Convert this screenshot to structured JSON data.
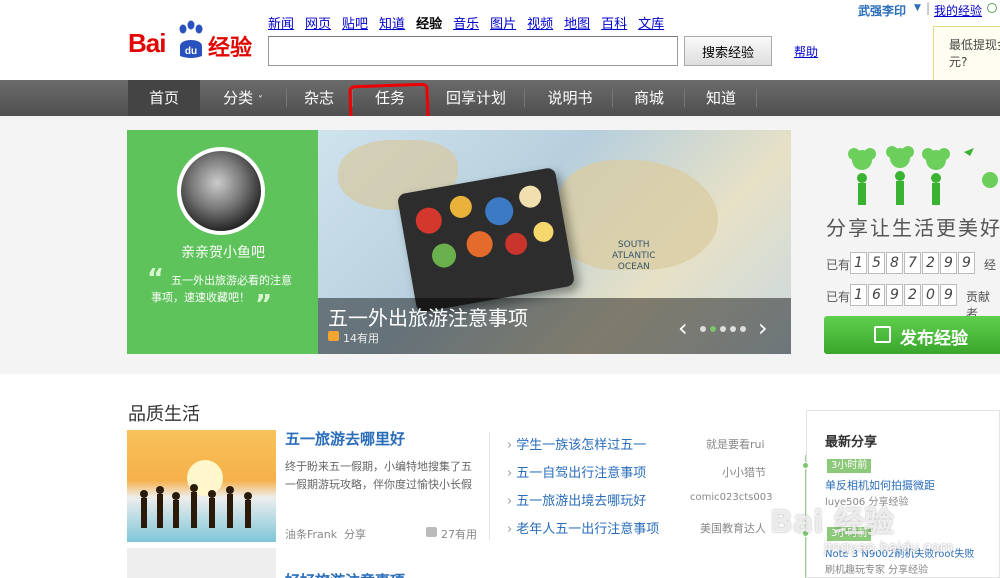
{
  "header": {
    "logo_text_bai": "Bai",
    "logo_text_du": "du",
    "logo_text_jy": "经验",
    "nav": [
      "新闻",
      "网页",
      "贴吧",
      "知道",
      "经验",
      "音乐",
      "图片",
      "视频",
      "地图",
      "百科",
      "文库"
    ],
    "current_nav": "经验",
    "search_placeholder": "",
    "search_button": "搜索经验",
    "help": "帮助",
    "user_name": "武强李印",
    "user_sep": "|",
    "my_experience": "我的经验",
    "tooltip_text": "最低提现金元?"
  },
  "main_nav": {
    "items": [
      "首页",
      "分类",
      "杂志",
      "任务",
      "回享计划",
      "说明书",
      "商城",
      "知道"
    ],
    "caret": "˅"
  },
  "promo": {
    "name": "亲亲贺小鱼吧",
    "quote_open": "“",
    "quote_close": "”",
    "text": "五一外出旅游必看的注意事项，速速收藏吧！"
  },
  "slide": {
    "title": "五一外出旅游注意事项",
    "useful": "14有用",
    "map_label": "SOUTH\nATLANTIC\nOCEAN",
    "prev": "‹",
    "next": "›",
    "dots": 5,
    "active_dot": 1
  },
  "share_panel": {
    "slogan": "分享让生活更美好",
    "row1_prefix": "已有",
    "row1_digits": [
      "1",
      "5",
      "8",
      "7",
      "2",
      "9",
      "9"
    ],
    "row1_suffix": "经",
    "row2_prefix": "已有",
    "row2_digits": [
      "1",
      "6",
      "9",
      "2",
      "0",
      "9"
    ],
    "row2_suffix": "贡献者",
    "publish": "发布经验"
  },
  "section": {
    "title": "品质生活",
    "featured": {
      "title": "五一旅游去哪里好",
      "desc": "终于盼来五一假期，小编特地搜集了五一假期游玩攻略，伴你度过愉快小长假",
      "author": "油条Frank",
      "share": "分享",
      "useful": "27有用"
    },
    "list": [
      {
        "title": "学生一族该怎样过五一",
        "author": "就是要看rui"
      },
      {
        "title": "五一自驾出行注意事项",
        "author": "小小猎节"
      },
      {
        "title": "五一旅游出境去哪玩好",
        "author": "comic023cts003"
      },
      {
        "title": "老年人五一出行注意事项",
        "author": "美国教育达人"
      }
    ],
    "next_title": "好好旅游注意事项"
  },
  "latest": {
    "title": "最新分享",
    "items": [
      {
        "time": "3小时前",
        "text": "单反相机如何拍摄微距",
        "sub": "luye506 分享经验"
      },
      {
        "time": "3小时前",
        "text": "Note 3 N9002刷机失败root失败",
        "sub": "刷机趣玩专家 分享经验"
      }
    ]
  },
  "watermark": {
    "text": "Bai 经验",
    "url": "jingyan.baidu.com"
  },
  "colors": {
    "brand_red": "#e10602",
    "link_blue": "#2a6dba",
    "nav_gray": "#5b5b5b",
    "green": "#5ec35a",
    "annotation_red": "#e00000"
  }
}
